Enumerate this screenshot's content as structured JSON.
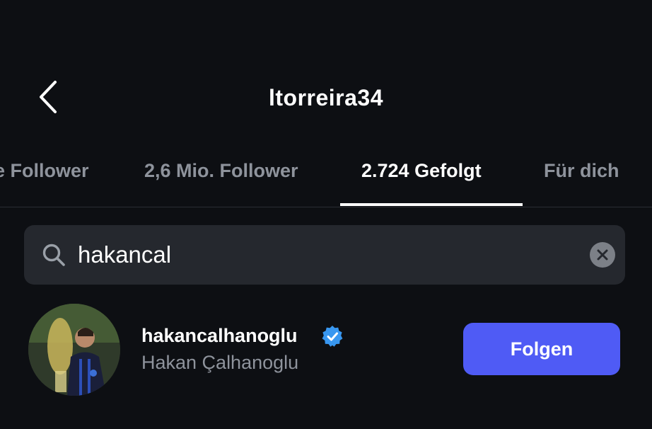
{
  "header": {
    "title": "ltorreira34",
    "back_icon": "chevron-left-icon"
  },
  "tabs": [
    {
      "label": "e Follower",
      "active": false
    },
    {
      "label": "2,6 Mio. Follower",
      "active": false
    },
    {
      "label": "2.724 Gefolgt",
      "active": true
    },
    {
      "label": "Für dich",
      "active": false
    }
  ],
  "search": {
    "value": "hakancal",
    "search_icon": "search-icon",
    "clear_icon": "clear-icon"
  },
  "result": {
    "username": "hakancalhanoglu",
    "full_name": "Hakan Çalhanoglu",
    "verified": true,
    "follow_label": "Folgen"
  },
  "colors": {
    "background": "#0d0f13",
    "search_bg": "#25282e",
    "follow_button": "#4f5bf5",
    "verified_badge": "#3897f0",
    "muted_text": "#8e939c"
  }
}
